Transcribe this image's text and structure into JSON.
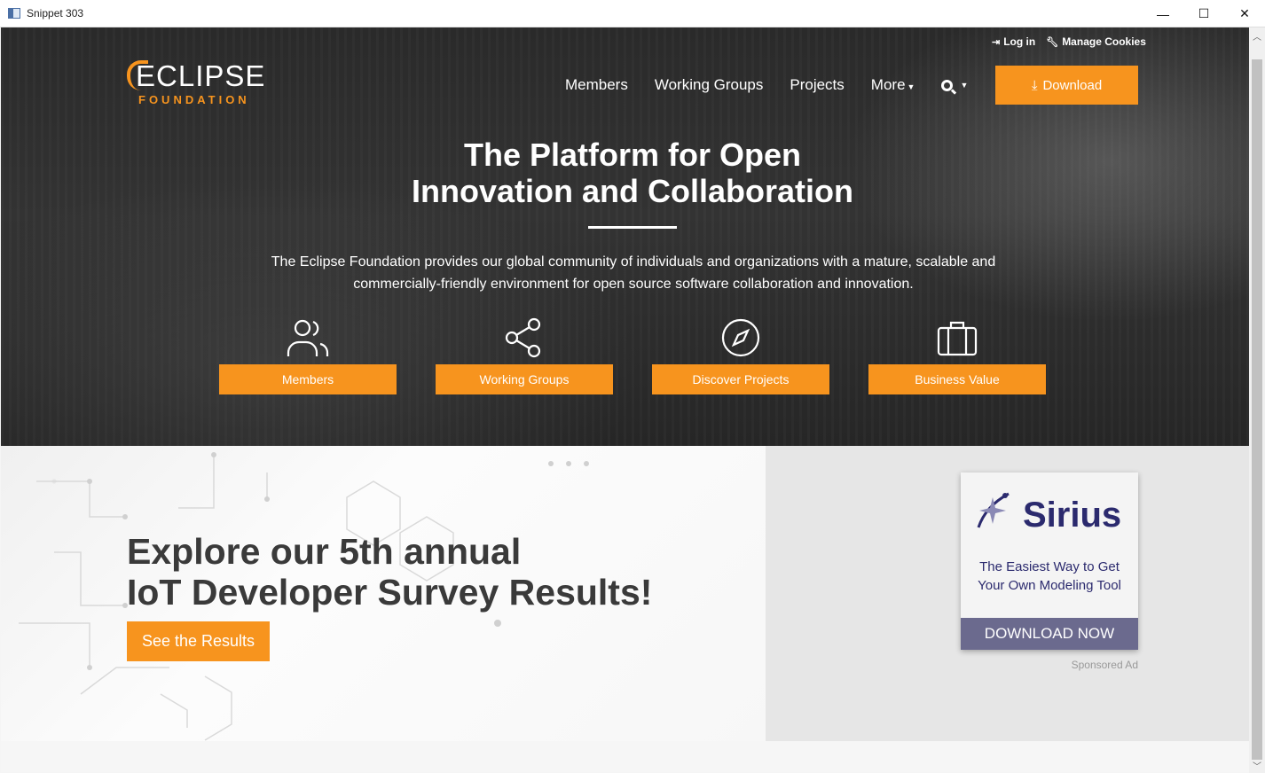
{
  "window": {
    "title": "Snippet 303",
    "minimize": "—",
    "maximize": "☐",
    "close": "✕"
  },
  "topper": {
    "login": "Log in",
    "cookies": "Manage Cookies"
  },
  "logo": {
    "word1": "ECLIPSE",
    "word2": "FOUNDATION"
  },
  "nav": {
    "members": "Members",
    "working_groups": "Working Groups",
    "projects": "Projects",
    "more": "More",
    "download": "Download"
  },
  "hero": {
    "title_line1": "The Platform for Open",
    "title_line2": "Innovation and Collaboration",
    "description": "The Eclipse Foundation provides our global community of individuals and organizations with a mature, scalable and commercially-friendly environment for open source software collaboration and innovation."
  },
  "features": [
    {
      "label": "Members",
      "icon": "users-icon"
    },
    {
      "label": "Working Groups",
      "icon": "share-icon"
    },
    {
      "label": "Discover Projects",
      "icon": "compass-icon"
    },
    {
      "label": "Business Value",
      "icon": "briefcase-icon"
    }
  ],
  "promo": {
    "title_line1": "Explore our 5th annual",
    "title_line2": "IoT Developer Survey Results!",
    "button": "See the Results"
  },
  "ad": {
    "brand": "Sirius",
    "tagline_line1": "The Easiest Way to Get",
    "tagline_line2": "Your Own Modeling Tool",
    "cta": "DOWNLOAD NOW",
    "label": "Sponsored Ad"
  },
  "colors": {
    "accent": "#f7941e",
    "hero_bg": "#2e2e2e",
    "ad_brand": "#2b2a6e"
  }
}
